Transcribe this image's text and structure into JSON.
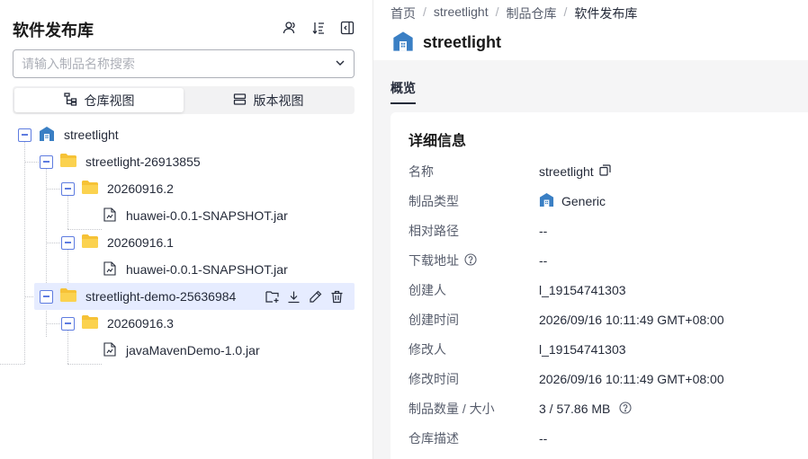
{
  "sidebar": {
    "title": "软件发布库",
    "search": {
      "placeholder": "请输入制品名称搜索",
      "value": ""
    },
    "view_tabs": [
      {
        "label": "仓库视图",
        "active": true,
        "icon": "tree-view-icon"
      },
      {
        "label": "版本视图",
        "active": false,
        "icon": "version-view-icon"
      }
    ],
    "tree": [
      {
        "label": "streetlight",
        "type": "repository",
        "level": 0,
        "expanded": true
      },
      {
        "label": "streetlight-26913855",
        "type": "folder",
        "level": 1,
        "expanded": true
      },
      {
        "label": "20260916.2",
        "type": "folder",
        "level": 2,
        "expanded": true
      },
      {
        "label": "huawei-0.0.1-SNAPSHOT.jar",
        "type": "file",
        "level": 3
      },
      {
        "label": "20260916.1",
        "type": "folder",
        "level": 2,
        "expanded": true
      },
      {
        "label": "huawei-0.0.1-SNAPSHOT.jar",
        "type": "file",
        "level": 3
      },
      {
        "label": "streetlight-demo-25636984",
        "type": "folder",
        "level": 1,
        "expanded": true,
        "selected": true
      },
      {
        "label": "20260916.3",
        "type": "folder",
        "level": 2,
        "expanded": true
      },
      {
        "label": "javaMavenDemo-1.0.jar",
        "type": "file",
        "level": 3
      }
    ],
    "row_actions": [
      "add-folder-icon",
      "download-icon",
      "edit-icon",
      "delete-icon"
    ]
  },
  "breadcrumb": [
    "首页",
    "streetlight",
    "制品仓库",
    "软件发布库"
  ],
  "repo": {
    "name": "streetlight"
  },
  "tabs": [
    {
      "label": "概览",
      "active": true
    }
  ],
  "details": {
    "title": "详细信息",
    "rows": [
      {
        "label": "名称",
        "value": "streetlight"
      },
      {
        "label": "制品类型",
        "value": "Generic"
      },
      {
        "label": "相对路径",
        "value": "--"
      },
      {
        "label": "下载地址",
        "value": "--"
      },
      {
        "label": "创建人",
        "value": "l_19154741303"
      },
      {
        "label": "创建时间",
        "value": "2026/09/16 10:11:49 GMT+08:00"
      },
      {
        "label": "修改人",
        "value": "l_19154741303"
      },
      {
        "label": "修改时间",
        "value": "2026/09/16 10:11:49 GMT+08:00"
      },
      {
        "label": "制品数量 / 大小",
        "value": "3 / 57.86 MB"
      },
      {
        "label": "仓库描述",
        "value": "--"
      }
    ]
  },
  "colors": {
    "accent": "#5e7ce0",
    "folder": "#f6c236",
    "repo_icon": "#3a7fc4",
    "selected_bg": "#e6ecff"
  }
}
